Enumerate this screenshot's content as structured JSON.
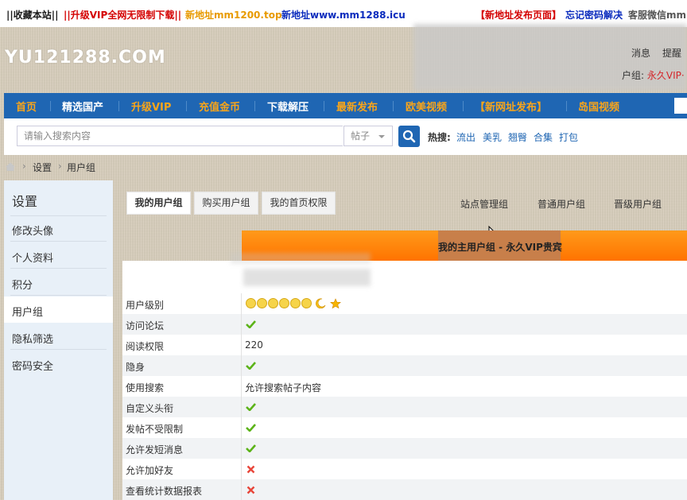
{
  "topbar": {
    "items": [
      {
        "text": "||收藏本站||",
        "color": "#1a1a1a"
      },
      {
        "text": "||升级VIP全网无限制下载||",
        "color": "#d40000"
      },
      {
        "text": "新地址mm1200.top",
        "color": "#e89a00"
      },
      {
        "text": "新地址www.mm1288.icu",
        "color": "#0a2bbd"
      },
      {
        "text": "【新地址发布页面】",
        "color": "#d40000"
      },
      {
        "text": "忘记密码解决",
        "color": "#0a2bbd"
      },
      {
        "text": "客服微信mm",
        "color": "#555555"
      }
    ]
  },
  "header": {
    "logo": "YU121288.COM",
    "messages": "消息",
    "reminders": "提醒",
    "group_prefix": "户组: ",
    "group_value": "永久VIP·"
  },
  "nav": {
    "items": [
      {
        "label": "首页",
        "hot": true
      },
      {
        "label": "精选国产",
        "hot": false
      },
      {
        "label": "升级VIP",
        "hot": true
      },
      {
        "label": "充值金币",
        "hot": true
      },
      {
        "label": "下载解压",
        "hot": false
      },
      {
        "label": "最新发布",
        "hot": true
      },
      {
        "label": "欧美视频",
        "hot": true
      },
      {
        "label": "【新网址发布】",
        "hot": true
      },
      {
        "label": "岛国视频",
        "hot": true
      }
    ]
  },
  "search": {
    "placeholder": "请输入搜索内容",
    "type": "帖子",
    "hot_label": "热搜:",
    "hot_terms": [
      "流出",
      "美乳",
      "翘臀",
      "合集",
      "打包"
    ]
  },
  "breadcrumb": {
    "items": [
      "设置",
      "用户组"
    ]
  },
  "sidebar": {
    "title": "设置",
    "items": [
      {
        "label": "修改头像",
        "active": false
      },
      {
        "label": "个人资料",
        "active": false
      },
      {
        "label": "积分",
        "active": false
      },
      {
        "label": "用户组",
        "active": true
      },
      {
        "label": "隐私筛选",
        "active": false
      },
      {
        "label": "密码安全",
        "active": false
      }
    ]
  },
  "tabs": {
    "left": [
      "我的用户组",
      "购买用户组",
      "我的首页权限"
    ],
    "right": [
      "站点管理组",
      "普通用户组",
      "晋级用户组"
    ]
  },
  "group_panel": {
    "title": "我的主用户组 - 永久VIP贵宾"
  },
  "permissions": [
    {
      "label": "用户级别",
      "type": "level"
    },
    {
      "label": "访问论坛",
      "type": "check"
    },
    {
      "label": "阅读权限",
      "type": "text",
      "value": "220"
    },
    {
      "label": "隐身",
      "type": "check"
    },
    {
      "label": "使用搜索",
      "type": "text",
      "value": "允许搜索帖子内容"
    },
    {
      "label": "自定义头衔",
      "type": "check"
    },
    {
      "label": "发帖不受限制",
      "type": "check"
    },
    {
      "label": "允许发短消息",
      "type": "check"
    },
    {
      "label": "允许加好友",
      "type": "cross"
    },
    {
      "label": "查看统计数据报表",
      "type": "cross"
    }
  ],
  "colors": {
    "nav": "#1f66b3",
    "nav_hot": "#f9a51a",
    "orange": "#ff8200",
    "check": "#5cb318",
    "cross": "#e8463a"
  }
}
